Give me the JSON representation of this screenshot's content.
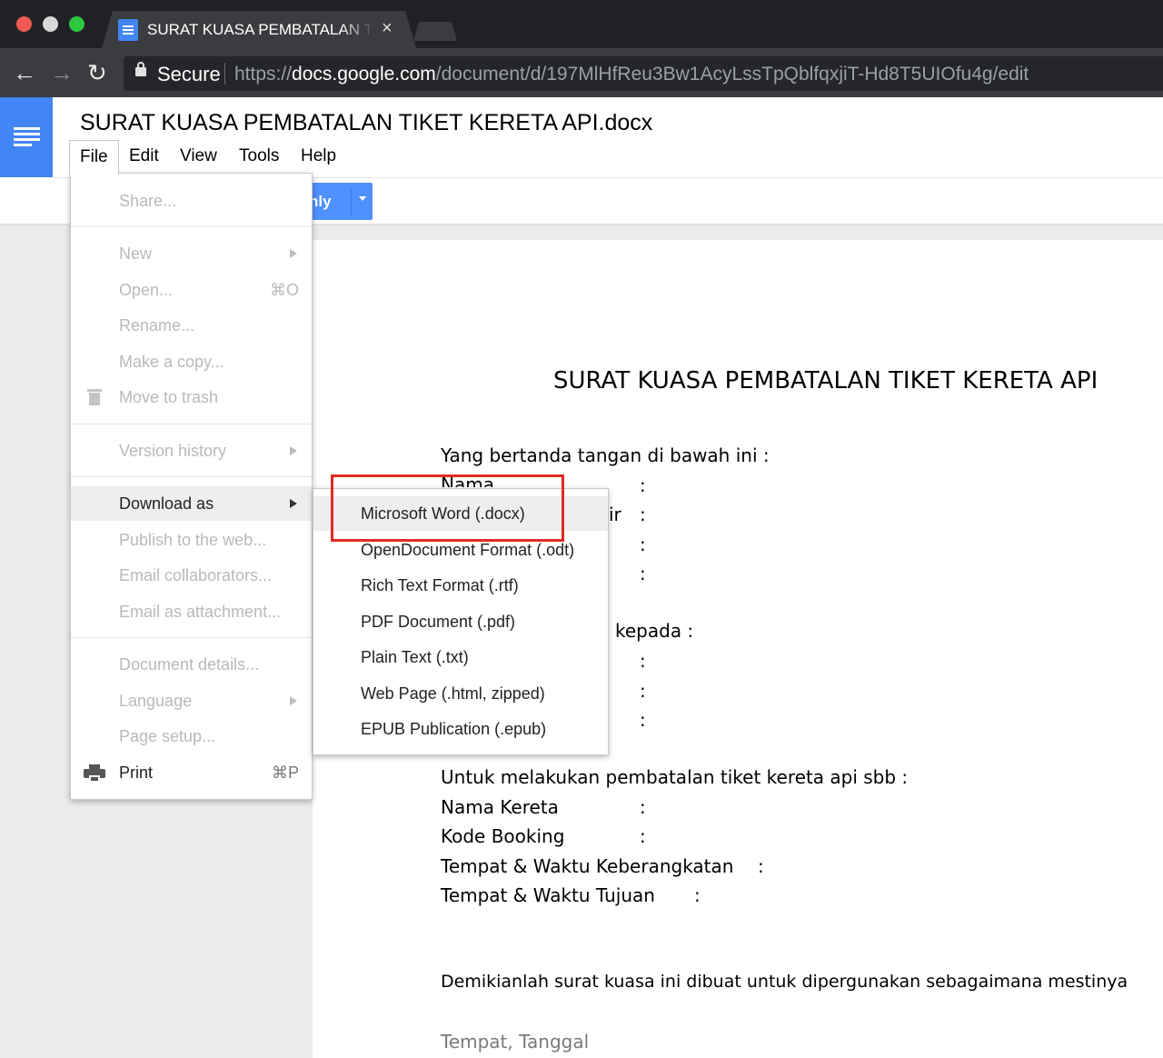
{
  "browser": {
    "tab_title": "SURAT KUASA PEMBATALAN TIKET KERETA API.docx",
    "tab_close": "×",
    "secure_label": "Secure",
    "url_scheme": "https://",
    "url_host": "docs.google.com",
    "url_path": "/document/d/197MlHfReu3Bw1AcyLssTpQblfqxjiT-Hd8T5UIOfu4g/edit",
    "back_glyph": "←",
    "forward_glyph": "→",
    "reload_glyph": "↻"
  },
  "docs": {
    "title": "SURAT KUASA PEMBATALAN TIKET KERETA API.docx",
    "menu": [
      "File",
      "Edit",
      "View",
      "Tools",
      "Help"
    ],
    "share_button_partial": "nly"
  },
  "file_menu": {
    "share": "Share...",
    "new": "New",
    "open": "Open...",
    "open_shortcut": "⌘O",
    "rename": "Rename...",
    "make_copy": "Make a copy...",
    "move_to_trash": "Move to trash",
    "version_history": "Version history",
    "download_as": "Download as",
    "publish": "Publish to the web...",
    "email_collaborators": "Email collaborators...",
    "email_attachment": "Email as attachment...",
    "document_details": "Document details...",
    "language": "Language",
    "page_setup": "Page setup...",
    "print": "Print",
    "print_shortcut": "⌘P"
  },
  "download_menu": {
    "items": [
      "Microsoft Word (.docx)",
      "OpenDocument Format (.odt)",
      "Rich Text Format (.rtf)",
      "PDF Document (.pdf)",
      "Plain Text (.txt)",
      "Web Page (.html, zipped)",
      "EPUB Publication (.epub)"
    ]
  },
  "document": {
    "heading": "SURAT KUASA PEMBATALAN TIKET KERETA API",
    "intro": "Yang bertanda tangan di bawah ini :",
    "nama_partial": "Nama",
    "field_partial": "ir",
    "colon": ":",
    "kepada_partial": "kepada :",
    "purpose": "Untuk melakukan pembatalan tiket kereta api sbb :",
    "nama_kereta": "Nama Kereta",
    "kode_booking": "Kode Booking",
    "berangkat": "Tempat & Waktu Keberangkatan",
    "tujuan": "Tempat & Waktu Tujuan",
    "closing": "Demikianlah surat kuasa ini dibuat untuk dipergunakan sebagaimana mestinya",
    "tempat_tanggal": "Tempat, Tanggal"
  }
}
